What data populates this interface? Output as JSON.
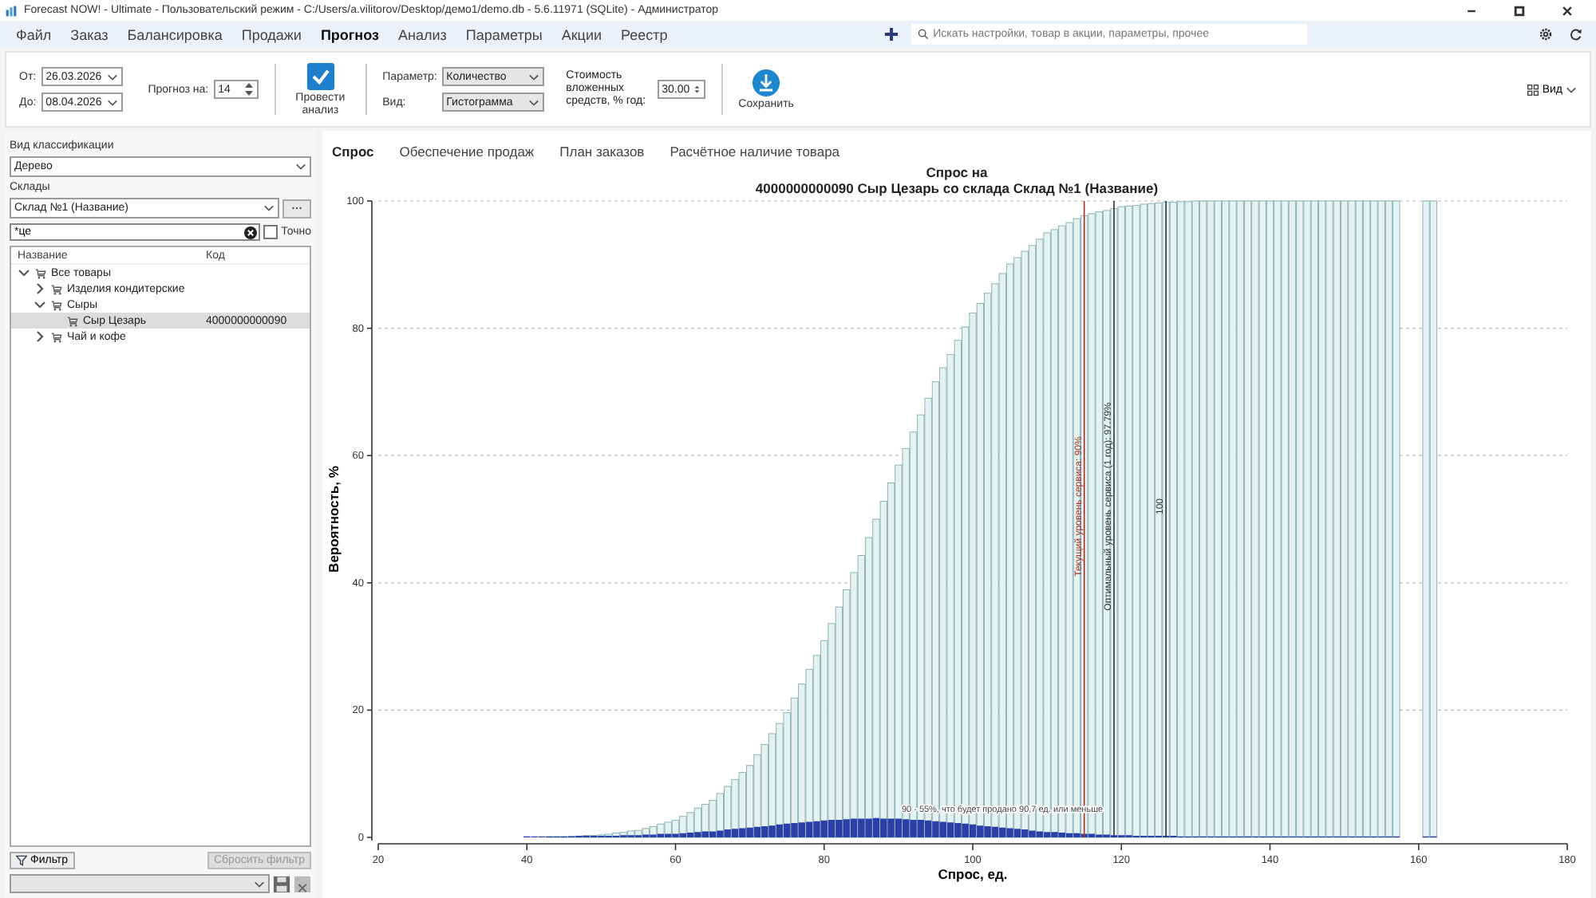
{
  "window": {
    "title": "Forecast NOW! - Ultimate - Пользовательский режим - C:/Users/a.vilitorov/Desktop/демо1/demo.db - 5.6.11971 (SQLite) - Администратор"
  },
  "menu": [
    {
      "label": "Файл",
      "selected": false
    },
    {
      "label": "Заказ",
      "selected": false
    },
    {
      "label": "Балансировка",
      "selected": false
    },
    {
      "label": "Продажи",
      "selected": false
    },
    {
      "label": "Прогноз",
      "selected": true
    },
    {
      "label": "Анализ",
      "selected": false
    },
    {
      "label": "Параметры",
      "selected": false
    },
    {
      "label": "Акции",
      "selected": false
    },
    {
      "label": "Реестр",
      "selected": false
    }
  ],
  "search": {
    "placeholder": "Искать настройки, товар в акции, параметры, прочее"
  },
  "toolbar": {
    "from_label": "От:",
    "from_value": "26.03.2026",
    "to_label": "До:",
    "to_value": "08.04.2026",
    "horizon_label": "Прогноз на:",
    "horizon_value": "14",
    "analyze_button": "Провести анализ",
    "parameter_label": "Параметр:",
    "parameter_value": "Количество",
    "view_label": "Вид:",
    "view_value": "Гистограмма",
    "cost_label": "Стоимость вложенных средств, % год:",
    "cost_value": "30.00",
    "save_button": "Сохранить",
    "view_menu": "Вид"
  },
  "sidebar": {
    "classification_label": "Вид классификации",
    "classification_value": "Дерево",
    "warehouses_label": "Склады",
    "warehouse_value": "Склад №1 (Название)",
    "filter_value": "*це",
    "exact": {
      "label": "Точно",
      "checked": false
    },
    "columns": [
      "Название",
      "Код"
    ],
    "tree": [
      {
        "name": "Все товары",
        "expanded": true,
        "selected": false,
        "children": [
          {
            "name": "Изделия кондитерские",
            "expanded": false,
            "selected": false
          },
          {
            "name": "Сыры",
            "expanded": true,
            "selected": false,
            "children": [
              {
                "name": "Сыр Цезарь",
                "code": "4000000000090",
                "selected": true
              }
            ]
          },
          {
            "name": "Чай и кофе",
            "expanded": false,
            "selected": false
          }
        ]
      }
    ],
    "filter_button": "Фильтр",
    "reset_button": {
      "label": "Сбросить фильтр",
      "disabled": true
    }
  },
  "tabs": [
    {
      "label": "Спрос",
      "selected": true
    },
    {
      "label": "Обеспечение продаж",
      "selected": false
    },
    {
      "label": "План заказов",
      "selected": false
    },
    {
      "label": "Расчётное наличие товара",
      "selected": false
    }
  ],
  "chart_data": {
    "type": "bar",
    "title": "Спрос на\n4000000000090 Сыр Цезарь со склада Склад №1 (Название)",
    "xlabel": "Спрос, ед.",
    "ylabel": "Вероятность, %",
    "stacked": false,
    "x": [
      40,
      41,
      42,
      43,
      44,
      45,
      46,
      47,
      48,
      49,
      50,
      51,
      52,
      53,
      54,
      55,
      56,
      57,
      58,
      59,
      60,
      61,
      62,
      63,
      64,
      65,
      66,
      67,
      68,
      69,
      70,
      71,
      72,
      73,
      74,
      75,
      76,
      77,
      78,
      79,
      80,
      81,
      82,
      83,
      84,
      85,
      86,
      87,
      88,
      89,
      90,
      91,
      92,
      93,
      94,
      95,
      96,
      97,
      98,
      99,
      100,
      101,
      102,
      103,
      104,
      105,
      106,
      107,
      108,
      109,
      110,
      111,
      112,
      113,
      114,
      115,
      116,
      117,
      118,
      119,
      120,
      121,
      122,
      123,
      124,
      125,
      126,
      127,
      128,
      129,
      130,
      131,
      132,
      133,
      134,
      135,
      136,
      137,
      138,
      139,
      140,
      141,
      142,
      143,
      144,
      145,
      146,
      147,
      148,
      149,
      150,
      151,
      152,
      153,
      154,
      155,
      156,
      157,
      161,
      162
    ],
    "series": [
      {
        "color": "#e4f2f2",
        "values": [
          0,
          0,
          0,
          0.1,
          0.1,
          0.1,
          0.2,
          0.2,
          0.3,
          0.3,
          0.4,
          0.5,
          0.7,
          0.8,
          1.0,
          1.1,
          1.4,
          1.7,
          2.1,
          2.4,
          2.7,
          3.3,
          3.9,
          4.6,
          5.2,
          5.8,
          6.9,
          8.0,
          9.1,
          10.2,
          11.3,
          13.0,
          14.6,
          16.3,
          17.9,
          19.6,
          21.9,
          24.1,
          26.4,
          28.6,
          30.9,
          33.6,
          36.2,
          38.9,
          41.6,
          44.3,
          47.1,
          50.0,
          52.8,
          55.7,
          58.5,
          61.1,
          63.7,
          66.4,
          69.0,
          71.6,
          73.8,
          75.9,
          78.1,
          80.2,
          82.4,
          83.9,
          85.5,
          87.0,
          88.6,
          90.1,
          91.1,
          92.1,
          93.0,
          94.0,
          95.0,
          95.5,
          96.1,
          96.6,
          97.2,
          97.7,
          98.0,
          98.3,
          98.5,
          98.8,
          99.1,
          99.2,
          99.3,
          99.5,
          99.6,
          99.7,
          99.8,
          99.8,
          99.9,
          99.9,
          100,
          100,
          100,
          100,
          100,
          100,
          100,
          100,
          100,
          100,
          100,
          100,
          100,
          100,
          100,
          100,
          100,
          100,
          100,
          100,
          100,
          100,
          100,
          100,
          100,
          100,
          100,
          100,
          100,
          100
        ]
      },
      {
        "color": "#2b3fa8",
        "values": [
          0,
          0,
          0,
          0,
          0,
          0,
          0,
          0.1,
          0.1,
          0.1,
          0.1,
          0.1,
          0.1,
          0.2,
          0.2,
          0.2,
          0.3,
          0.3,
          0.4,
          0.4,
          0.4,
          0.5,
          0.6,
          0.7,
          0.8,
          0.8,
          0.9,
          1.1,
          1.2,
          1.3,
          1.4,
          1.5,
          1.6,
          1.7,
          1.9,
          2.0,
          2.1,
          2.2,
          2.3,
          2.4,
          2.5,
          2.6,
          2.6,
          2.7,
          2.8,
          2.8,
          2.8,
          2.9,
          2.8,
          2.8,
          2.8,
          2.7,
          2.6,
          2.6,
          2.5,
          2.4,
          2.3,
          2.2,
          2.1,
          2.0,
          1.9,
          1.7,
          1.6,
          1.5,
          1.4,
          1.3,
          1.2,
          1.1,
          0.9,
          0.8,
          0.7,
          0.7,
          0.6,
          0.5,
          0.5,
          0.4,
          0.4,
          0.3,
          0.3,
          0.2,
          0.2,
          0.2,
          0.1,
          0.1,
          0.1,
          0.1,
          0.1,
          0.1,
          0,
          0,
          0,
          0,
          0,
          0,
          0,
          0,
          0,
          0,
          0,
          0,
          0,
          0,
          0,
          0,
          0,
          0,
          0,
          0,
          0,
          0,
          0,
          0,
          0,
          0,
          0,
          0,
          0,
          0,
          0,
          0
        ]
      }
    ],
    "grid": true,
    "xlim": [
      20,
      180
    ],
    "ylim": [
      0,
      100
    ],
    "xticks": [
      20,
      40,
      60,
      80,
      100,
      120,
      140,
      160,
      180
    ],
    "yticks": [
      0,
      20,
      40,
      60,
      80,
      100
    ],
    "ref_lines": [
      {
        "axis": "x",
        "value": 115,
        "color": "#a93226"
      },
      {
        "axis": "x",
        "value": 119,
        "color": "#333333"
      },
      {
        "axis": "x",
        "value": 126,
        "color": "#333333"
      }
    ],
    "annotations": [
      {
        "x": 115,
        "y": 52,
        "text": "Текущий уровень сервиса: 90%"
      },
      {
        "x": 119,
        "y": 52,
        "text": "Оптимальный уровень сервиса (1 год): 97.79%"
      },
      {
        "x": 126,
        "y": 52,
        "text": "100"
      },
      {
        "x": 90,
        "y": 4,
        "text": "90 - 55%, что будет продано 90,7 ед. или меньше"
      }
    ]
  }
}
